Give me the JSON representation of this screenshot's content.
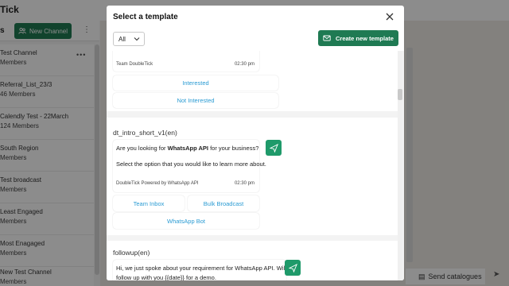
{
  "background": {
    "app_title": "Tick",
    "toolbar_label": "s",
    "new_channel_label": "New Channel",
    "channels": [
      {
        "name": "Test Channel",
        "sub": "Members"
      },
      {
        "name": "Referral_List_23/3",
        "sub": "46 Members"
      },
      {
        "name": "Calendly Test - 22March",
        "sub": "124 Members"
      },
      {
        "name": "South Region",
        "sub": "Members"
      },
      {
        "name": "Test broadcast",
        "sub": "Members"
      },
      {
        "name": "Least Engaged",
        "sub": "Members"
      },
      {
        "name": "Most Enagaged",
        "sub": "Members"
      },
      {
        "name": "New Test Channel",
        "sub": "Members"
      }
    ],
    "send_catalogues_label": "Send catalogues"
  },
  "modal": {
    "title": "Select a template",
    "filter_value": "All",
    "create_button_label": "Create new template",
    "templates": [
      {
        "footer": "Team DoubleTick",
        "time": "02:30 pm",
        "buttons": [
          "Interested",
          "Not Interested"
        ]
      },
      {
        "name": "dt_intro_short_v1(en)",
        "message_prefix": "Are you looking for ",
        "message_bold": "WhatsApp API",
        "message_suffix": " for your business?",
        "message_line2": "Select the option that you would like to learn more about.",
        "footer": "DoubleTick Powered by WhatsApp API",
        "time": "02:30 pm",
        "buttons": [
          "Team Inbox",
          "Bulk Broadcast",
          "WhatsApp Bot"
        ]
      },
      {
        "name": "followup(en)",
        "message_line1": "Hi, we just spoke about your requirement for WhatsApp API. Will",
        "message_line2": "follow up with you {{date}} for a demo."
      }
    ]
  },
  "colors": {
    "primary_green": "#1f7a53",
    "send_green": "#1f9a6a",
    "link_blue": "#2a9bd3"
  }
}
